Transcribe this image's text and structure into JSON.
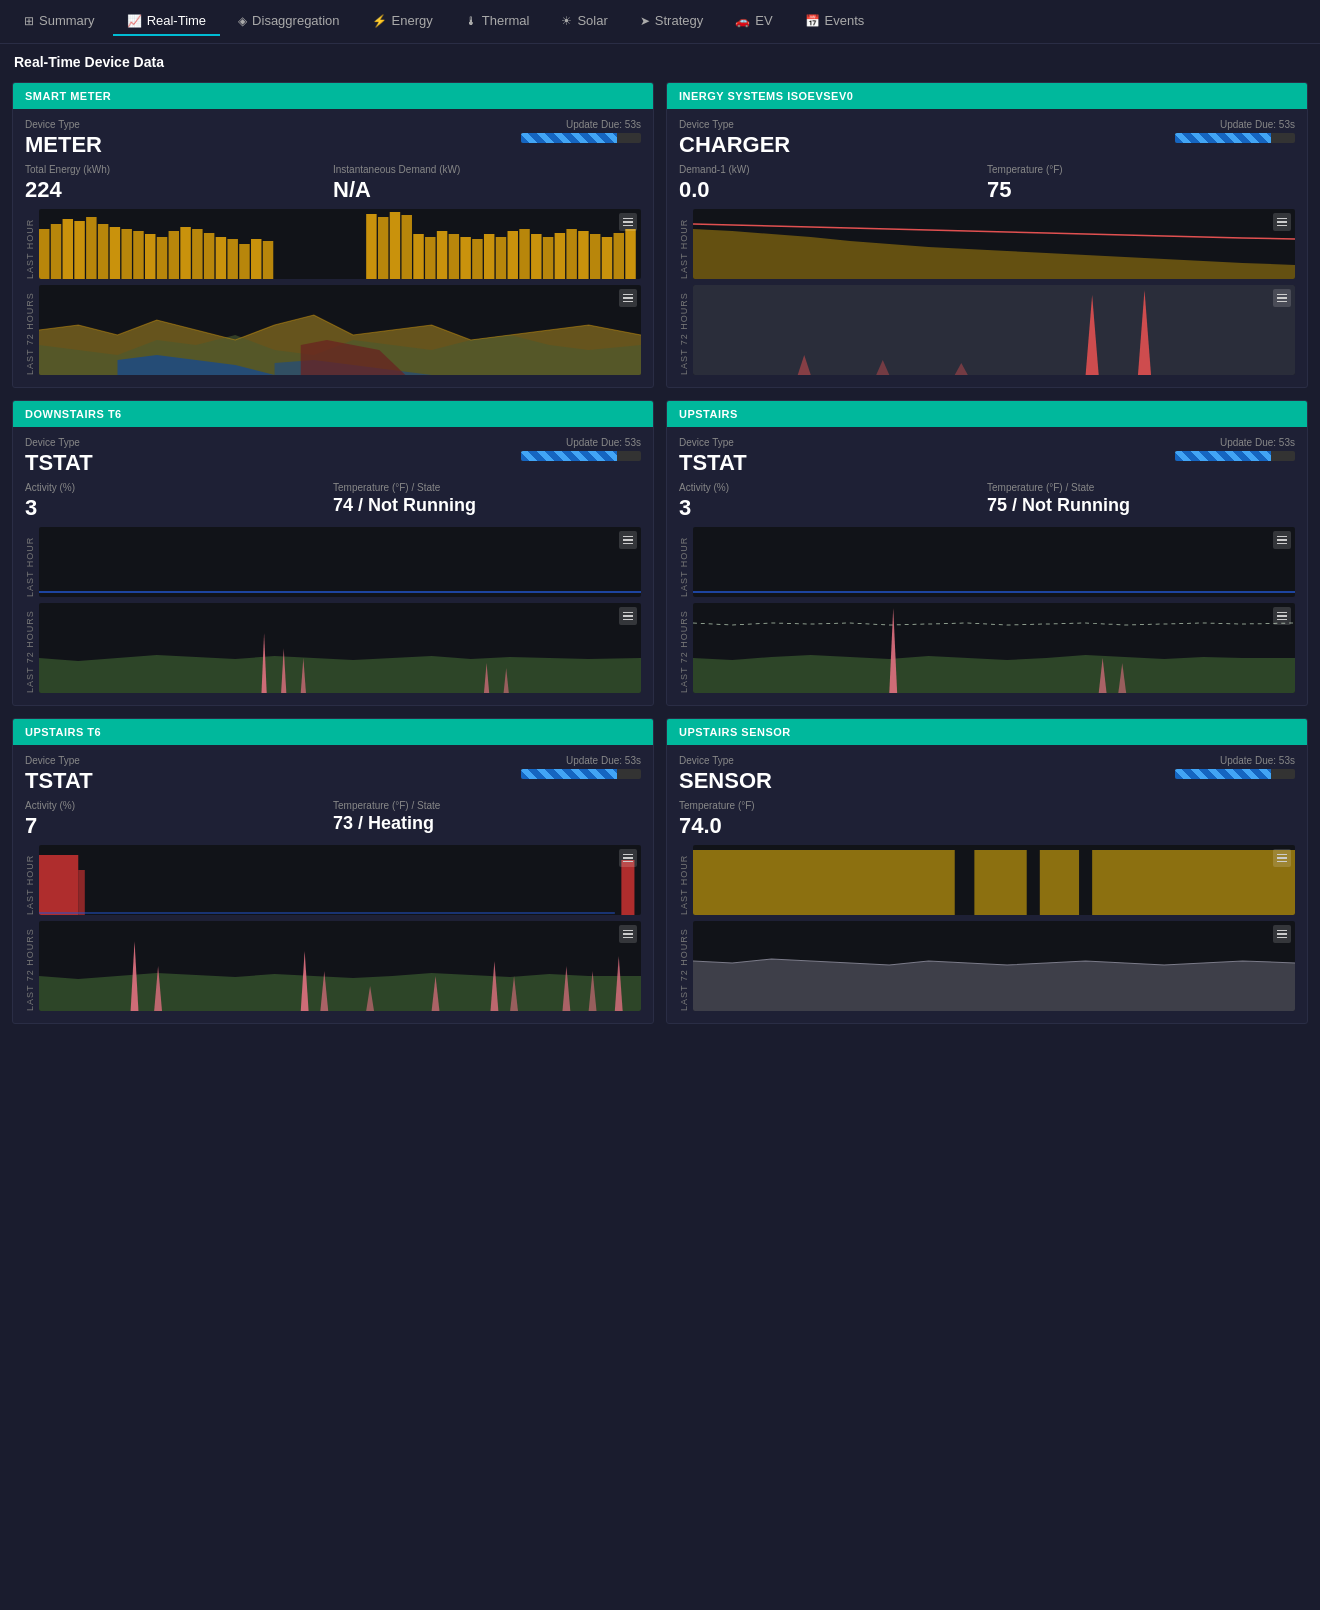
{
  "nav": {
    "items": [
      {
        "label": "Summary",
        "icon": "⊞",
        "active": false
      },
      {
        "label": "Real-Time",
        "icon": "📈",
        "active": true
      },
      {
        "label": "Disaggregation",
        "icon": "◈",
        "active": false
      },
      {
        "label": "Energy",
        "icon": "⚡",
        "active": false
      },
      {
        "label": "Thermal",
        "icon": "🌡",
        "active": false
      },
      {
        "label": "Solar",
        "icon": "☀",
        "active": false
      },
      {
        "label": "Strategy",
        "icon": "➤",
        "active": false
      },
      {
        "label": "EV",
        "icon": "🚗",
        "active": false
      },
      {
        "label": "Events",
        "icon": "📅",
        "active": false
      }
    ]
  },
  "page_title": "Real-Time Device Data",
  "cards": [
    {
      "id": "smart-meter",
      "header": "SMART METER",
      "device_type_label": "Device Type",
      "device_type": "METER",
      "update_due": "Update Due: 53s",
      "metrics": [
        {
          "label": "Total Energy (kWh)",
          "value": "224"
        },
        {
          "label": "Instantaneous Demand (kW)",
          "value": "N/A"
        }
      ]
    },
    {
      "id": "inergy",
      "header": "INERGY SYSTEMS ISOEVSEV0",
      "device_type_label": "Device Type",
      "device_type": "CHARGER",
      "update_due": "Update Due: 53s",
      "metrics": [
        {
          "label": "Demand-1 (kW)",
          "value": "0.0"
        },
        {
          "label": "Temperature (°F)",
          "value": "75"
        }
      ]
    },
    {
      "id": "downstairs-t6",
      "header": "DOWNSTAIRS T6",
      "device_type_label": "Device Type",
      "device_type": "TSTAT",
      "update_due": "Update Due: 53s",
      "metrics": [
        {
          "label": "Activity (%)",
          "value": "3"
        },
        {
          "label": "Temperature (°F) / State",
          "value": "74 / Not Running"
        }
      ]
    },
    {
      "id": "upstairs",
      "header": "UPSTAIRS",
      "device_type_label": "Device Type",
      "device_type": "TSTAT",
      "update_due": "Update Due: 53s",
      "metrics": [
        {
          "label": "Activity (%)",
          "value": "3"
        },
        {
          "label": "Temperature (°F) / State",
          "value": "75 / Not Running"
        }
      ]
    },
    {
      "id": "upstairs-t6",
      "header": "UPSTAIRS T6",
      "device_type_label": "Device Type",
      "device_type": "TSTAT",
      "update_due": "Update Due: 53s",
      "metrics": [
        {
          "label": "Activity (%)",
          "value": "7"
        },
        {
          "label": "Temperature (°F) / State",
          "value": "73 / Heating"
        }
      ]
    },
    {
      "id": "upstairs-sensor",
      "header": "UPSTAIRS SENSOR",
      "device_type_label": "Device Type",
      "device_type": "SENSOR",
      "update_due": "Update Due: 53s",
      "metrics": [
        {
          "label": "Temperature (°F)",
          "value": "74.0"
        }
      ]
    }
  ],
  "labels": {
    "last_hour": "LAST HOUR",
    "last_72h": "LAST 72 HOURS"
  }
}
